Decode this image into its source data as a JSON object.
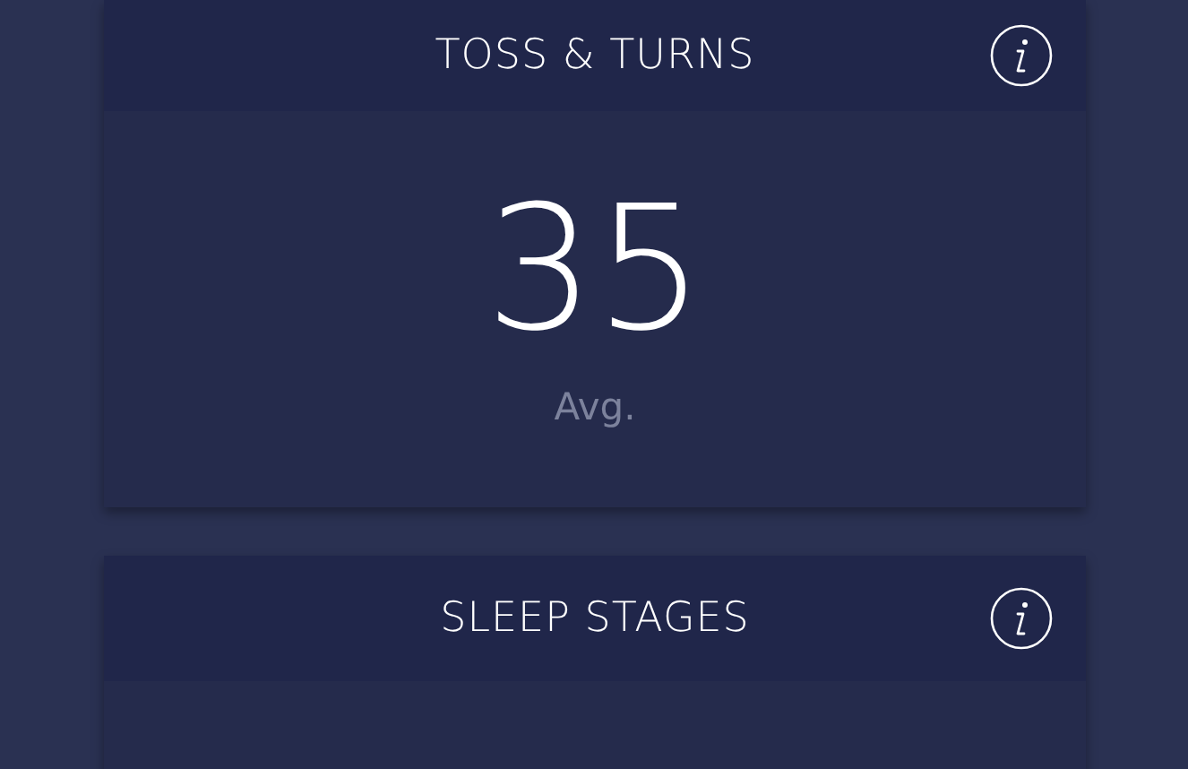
{
  "cards": [
    {
      "title": "TOSS & TURNS",
      "value": "35",
      "caption": "Avg."
    },
    {
      "title": "SLEEP STAGES"
    }
  ]
}
